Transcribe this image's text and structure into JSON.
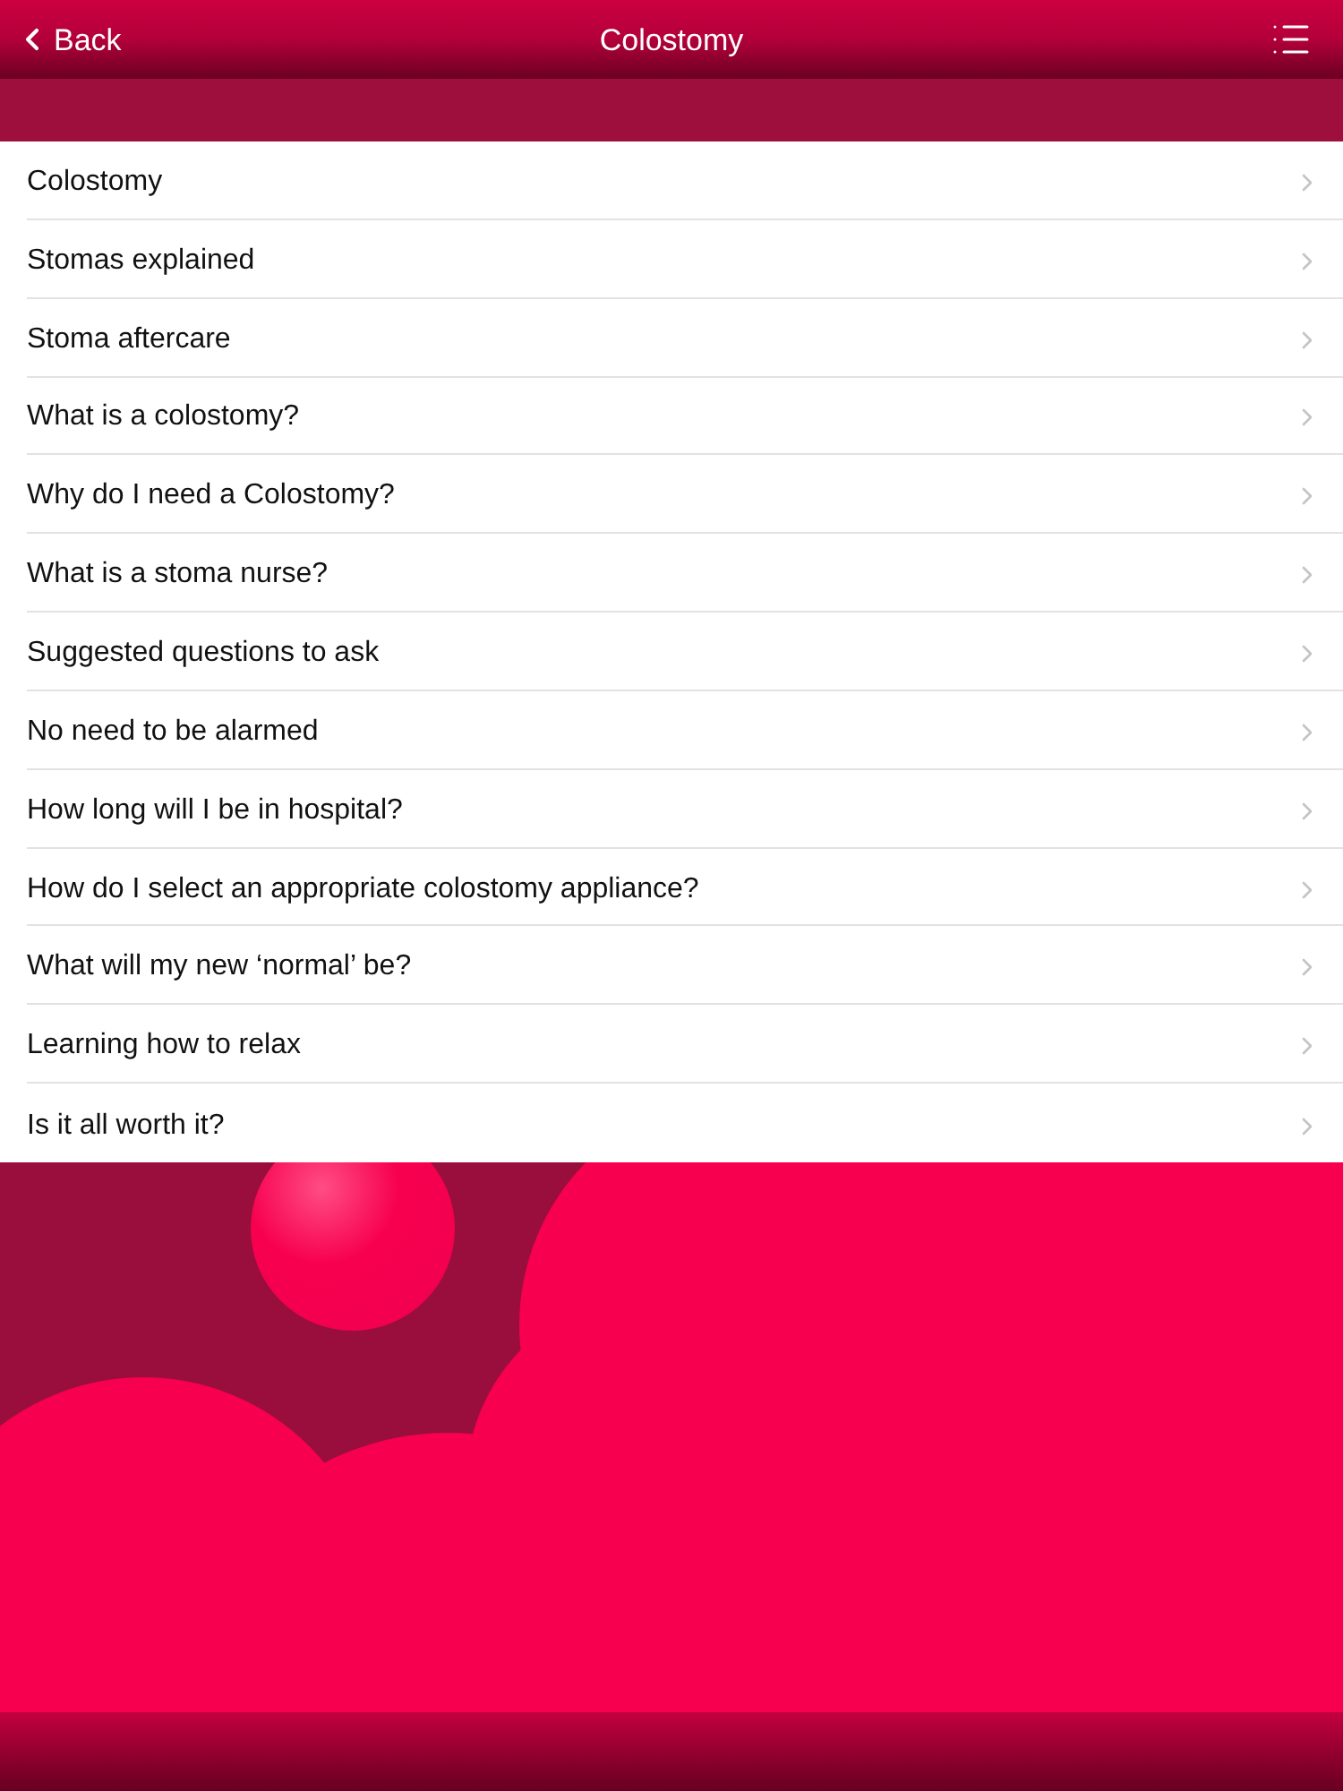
{
  "nav_bar": {
    "back_label": "Back",
    "title": "Colostomy"
  },
  "items": [
    {
      "label": "Colostomy"
    },
    {
      "label": "Stomas explained"
    },
    {
      "label": "Stoma aftercare"
    },
    {
      "label": "What is a colostomy?"
    },
    {
      "label": "Why do I need a Colostomy?"
    },
    {
      "label": "What is a stoma nurse?"
    },
    {
      "label": "Suggested questions to ask"
    },
    {
      "label": "No need to be alarmed"
    },
    {
      "label": "How long will I be in hospital?"
    },
    {
      "label": "How do I select an appropriate colostomy appliance?"
    },
    {
      "label": "What will my new ‘normal’ be?"
    },
    {
      "label": "Learning how to relax"
    },
    {
      "label": "Is it all worth it?"
    }
  ]
}
